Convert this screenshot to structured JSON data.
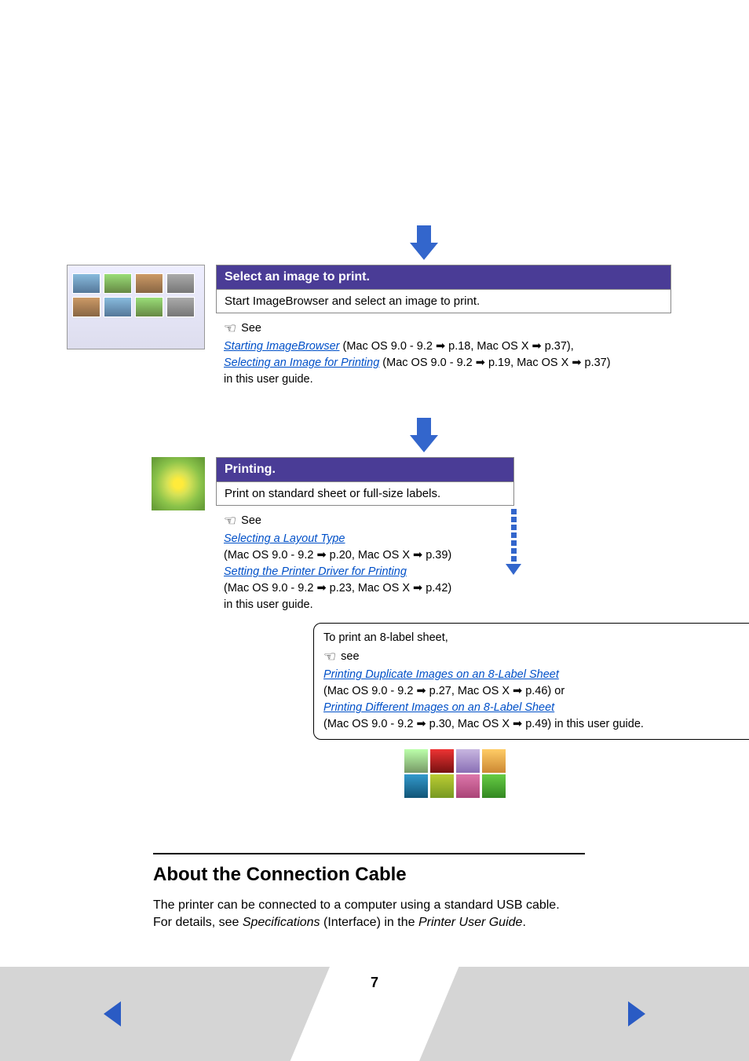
{
  "steps": {
    "select": {
      "title": "Select an image to print.",
      "desc": "Start ImageBrowser and select an image to print.",
      "see_label": "See",
      "link1": "Starting ImageBrowser",
      "link1_ref": " (Mac OS 9.0 - 9.2 ➡ p.18, Mac OS X ➡ p.37),",
      "link2": "Selecting an Image for Printing",
      "link2_ref": " (Mac OS 9.0 - 9.2 ➡ p.19, Mac OS X ➡ p.37)",
      "tail": "in this user guide."
    },
    "printing": {
      "title": "Printing.",
      "desc": "Print on standard sheet or full-size labels.",
      "see_label": "See",
      "link1": "Selecting a Layout Type",
      "link1_ref": "(Mac OS 9.0 - 9.2 ➡ p.20, Mac OS X ➡ p.39)",
      "link2": "Setting the Printer Driver for Printing",
      "link2_ref": "(Mac OS 9.0 - 9.2 ➡ p.23, Mac OS X ➡ p.42)",
      "tail": "in this user guide."
    }
  },
  "callout": {
    "intro": "To print an 8-label sheet,",
    "see_label": "see",
    "link1": "Printing Duplicate Images on an 8-Label Sheet",
    "link1_ref": "(Mac OS 9.0 - 9.2 ➡ p.27, Mac OS X ➡ p.46) or",
    "link2": "Printing Different Images on an 8-Label Sheet",
    "link2_ref": "(Mac OS 9.0 - 9.2 ➡ p.30, Mac OS X ➡ p.49) in this user guide."
  },
  "section": {
    "heading": "About the Connection Cable",
    "p1a": "The printer can be connected to a computer using a standard USB cable.",
    "p2a": "For details, see ",
    "p2b": "Specifications",
    "p2c": " (Interface) in the ",
    "p2d": "Printer User Guide",
    "p2e": "."
  },
  "page_number": "7"
}
